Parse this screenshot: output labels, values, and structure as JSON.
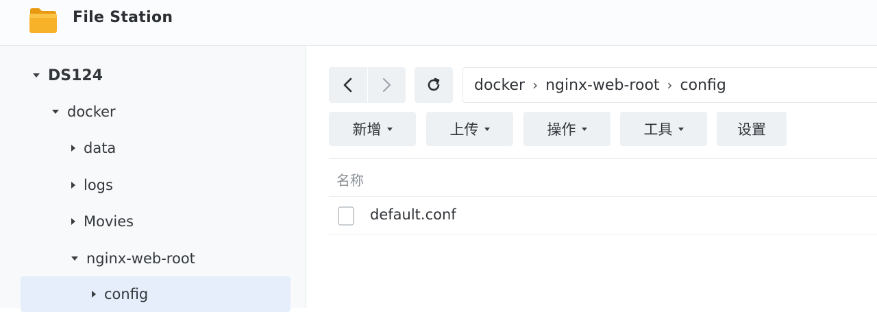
{
  "app": {
    "title": "File Station",
    "icon": "folder-icon",
    "accent_color": "#f5a623"
  },
  "sidebar": {
    "root": "DS124",
    "items": [
      {
        "label": "docker",
        "state": "expanded"
      },
      {
        "label": "data",
        "state": "collapsed"
      },
      {
        "label": "logs",
        "state": "collapsed"
      },
      {
        "label": "Movies",
        "state": "collapsed"
      },
      {
        "label": "nginx-web-root",
        "state": "expanded"
      },
      {
        "label": "config",
        "state": "collapsed",
        "selected": true
      }
    ],
    "selected_color": "#e5eefa"
  },
  "navigation": {
    "back_icon": "chevron-left-icon",
    "forward_icon": "chevron-right-icon",
    "refresh_icon": "refresh-icon"
  },
  "path": {
    "segments": [
      "docker",
      "nginx-web-root",
      "config"
    ],
    "separator": "›"
  },
  "toolbar": {
    "create_label": "新增",
    "upload_label": "上传",
    "action_label": "操作",
    "tools_label": "工具",
    "settings_label": "设置"
  },
  "file_list": {
    "columns": [
      "名称"
    ],
    "rows": [
      {
        "name": "default.conf",
        "icon": "file-icon"
      }
    ]
  }
}
